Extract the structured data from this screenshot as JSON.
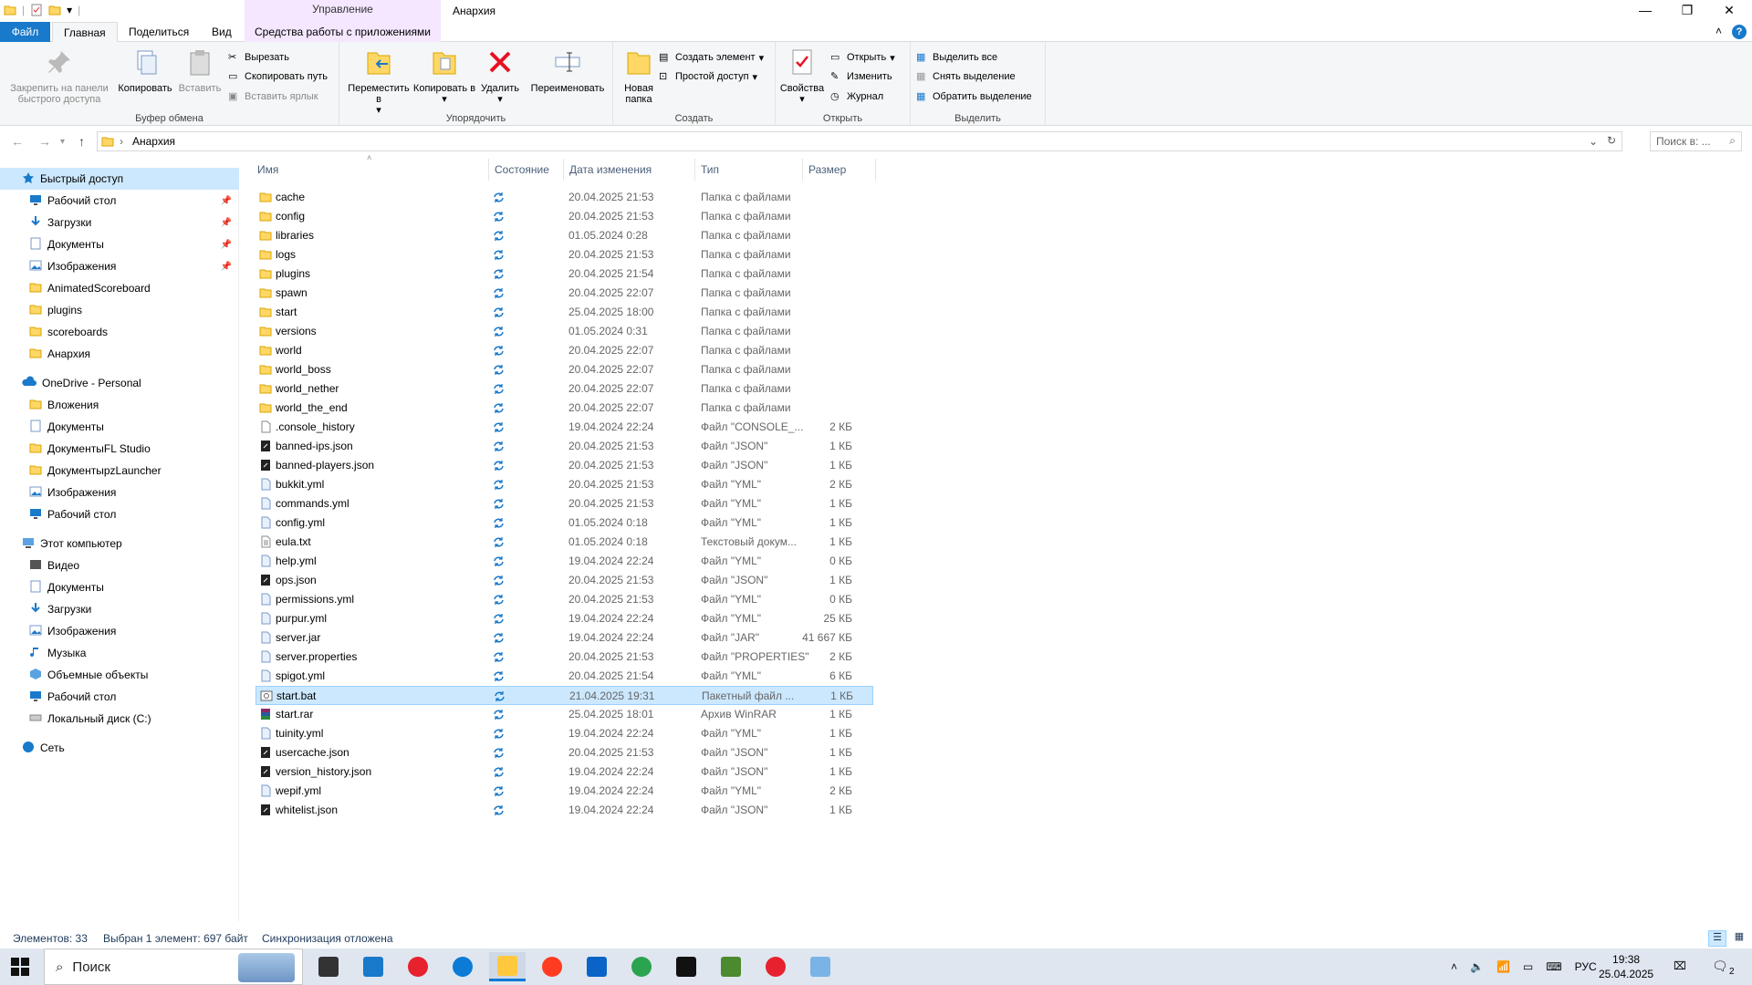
{
  "window": {
    "title": "Анархия",
    "context_tab": "Управление",
    "min_icon": "minimize-icon",
    "max_icon": "restore-icon",
    "close_icon": "close-icon"
  },
  "ribbon_tabs": [
    "Файл",
    "Главная",
    "Поделиться",
    "Вид",
    "Средства работы с приложениями"
  ],
  "clipboard": {
    "pin": "Закрепить на панели быстрого доступа",
    "copy": "Копировать",
    "paste": "Вставить",
    "cut": "Вырезать",
    "copy_path": "Скопировать путь",
    "paste_shortcut": "Вставить ярлык",
    "title": "Буфер обмена"
  },
  "organize": {
    "move": "Переместить в",
    "copy": "Копировать в",
    "delete": "Удалить",
    "rename": "Переименовать",
    "title": "Упорядочить"
  },
  "create": {
    "new_folder": "Новая папка",
    "new_item": "Создать элемент",
    "easy_access": "Простой доступ",
    "title": "Создать"
  },
  "open": {
    "properties": "Свойства",
    "open": "Открыть",
    "edit": "Изменить",
    "history": "Журнал",
    "title": "Открыть"
  },
  "select": {
    "all": "Выделить все",
    "none": "Снять выделение",
    "invert": "Обратить выделение",
    "title": "Выделить"
  },
  "address": {
    "path": "Анархия",
    "search_placeholder": "Поиск в: ..."
  },
  "nav_pane": [
    {
      "label": "Быстрый доступ",
      "icon": "star-icon",
      "level": 0,
      "pinned": false,
      "highlight": true
    },
    {
      "label": "Рабочий стол",
      "icon": "desktop-icon",
      "level": 1,
      "pinned": true
    },
    {
      "label": "Загрузки",
      "icon": "download-icon",
      "level": 1,
      "pinned": true
    },
    {
      "label": "Документы",
      "icon": "documents-icon",
      "level": 1,
      "pinned": true
    },
    {
      "label": "Изображения",
      "icon": "pictures-icon",
      "level": 1,
      "pinned": true
    },
    {
      "label": "AnimatedScoreboard",
      "icon": "folder-icon",
      "level": 1
    },
    {
      "label": "plugins",
      "icon": "folder-icon",
      "level": 1
    },
    {
      "label": "scoreboards",
      "icon": "folder-icon",
      "level": 1
    },
    {
      "label": "Анархия",
      "icon": "folder-icon",
      "level": 1
    },
    {
      "label": "OneDrive - Personal",
      "icon": "cloud-icon",
      "level": 0,
      "gap": true
    },
    {
      "label": "Вложения",
      "icon": "folder-icon",
      "level": 1
    },
    {
      "label": "Документы",
      "icon": "documents-icon",
      "level": 1
    },
    {
      "label": "ДокументыFL Studio",
      "icon": "folder-icon",
      "level": 1
    },
    {
      "label": "ДокументыpzLauncher",
      "icon": "folder-icon",
      "level": 1
    },
    {
      "label": "Изображения",
      "icon": "pictures-icon",
      "level": 1
    },
    {
      "label": "Рабочий стол",
      "icon": "desktop-icon",
      "level": 1
    },
    {
      "label": "Этот компьютер",
      "icon": "computer-icon",
      "level": 0,
      "gap": true
    },
    {
      "label": "Видео",
      "icon": "video-icon",
      "level": 1
    },
    {
      "label": "Документы",
      "icon": "documents-icon",
      "level": 1
    },
    {
      "label": "Загрузки",
      "icon": "download-icon",
      "level": 1
    },
    {
      "label": "Изображения",
      "icon": "pictures-icon",
      "level": 1
    },
    {
      "label": "Музыка",
      "icon": "music-icon",
      "level": 1
    },
    {
      "label": "Объемные объекты",
      "icon": "3d-objects-icon",
      "level": 1
    },
    {
      "label": "Рабочий стол",
      "icon": "desktop-icon",
      "level": 1
    },
    {
      "label": "Локальный диск (C:)",
      "icon": "drive-icon",
      "level": 1
    },
    {
      "label": "Сеть",
      "icon": "network-icon",
      "level": 0,
      "gap": true
    }
  ],
  "columns": {
    "name": "Имя",
    "status": "Состояние",
    "date": "Дата изменения",
    "type": "Тип",
    "size": "Размер"
  },
  "files": [
    {
      "name": "cache",
      "date": "20.04.2025 21:53",
      "type": "Папка с файлами",
      "size": "",
      "kind": "folder"
    },
    {
      "name": "config",
      "date": "20.04.2025 21:53",
      "type": "Папка с файлами",
      "size": "",
      "kind": "folder"
    },
    {
      "name": "libraries",
      "date": "01.05.2024 0:28",
      "type": "Папка с файлами",
      "size": "",
      "kind": "folder"
    },
    {
      "name": "logs",
      "date": "20.04.2025 21:53",
      "type": "Папка с файлами",
      "size": "",
      "kind": "folder"
    },
    {
      "name": "plugins",
      "date": "20.04.2025 21:54",
      "type": "Папка с файлами",
      "size": "",
      "kind": "folder"
    },
    {
      "name": "spawn",
      "date": "20.04.2025 22:07",
      "type": "Папка с файлами",
      "size": "",
      "kind": "folder"
    },
    {
      "name": "start",
      "date": "25.04.2025 18:00",
      "type": "Папка с файлами",
      "size": "",
      "kind": "folder"
    },
    {
      "name": "versions",
      "date": "01.05.2024 0:31",
      "type": "Папка с файлами",
      "size": "",
      "kind": "folder"
    },
    {
      "name": "world",
      "date": "20.04.2025 22:07",
      "type": "Папка с файлами",
      "size": "",
      "kind": "folder"
    },
    {
      "name": "world_boss",
      "date": "20.04.2025 22:07",
      "type": "Папка с файлами",
      "size": "",
      "kind": "folder"
    },
    {
      "name": "world_nether",
      "date": "20.04.2025 22:07",
      "type": "Папка с файлами",
      "size": "",
      "kind": "folder"
    },
    {
      "name": "world_the_end",
      "date": "20.04.2025 22:07",
      "type": "Папка с файлами",
      "size": "",
      "kind": "folder"
    },
    {
      "name": ".console_history",
      "date": "19.04.2024 22:24",
      "type": "Файл \"CONSOLE_...",
      "size": "2 КБ",
      "kind": "blank"
    },
    {
      "name": "banned-ips.json",
      "date": "20.04.2025 21:53",
      "type": "Файл \"JSON\"",
      "size": "1 КБ",
      "kind": "json"
    },
    {
      "name": "banned-players.json",
      "date": "20.04.2025 21:53",
      "type": "Файл \"JSON\"",
      "size": "1 КБ",
      "kind": "json"
    },
    {
      "name": "bukkit.yml",
      "date": "20.04.2025 21:53",
      "type": "Файл \"YML\"",
      "size": "2 КБ",
      "kind": "yml"
    },
    {
      "name": "commands.yml",
      "date": "20.04.2025 21:53",
      "type": "Файл \"YML\"",
      "size": "1 КБ",
      "kind": "yml"
    },
    {
      "name": "config.yml",
      "date": "01.05.2024 0:18",
      "type": "Файл \"YML\"",
      "size": "1 КБ",
      "kind": "yml"
    },
    {
      "name": "eula.txt",
      "date": "01.05.2024 0:18",
      "type": "Текстовый докум...",
      "size": "1 КБ",
      "kind": "txt"
    },
    {
      "name": "help.yml",
      "date": "19.04.2024 22:24",
      "type": "Файл \"YML\"",
      "size": "0 КБ",
      "kind": "yml"
    },
    {
      "name": "ops.json",
      "date": "20.04.2025 21:53",
      "type": "Файл \"JSON\"",
      "size": "1 КБ",
      "kind": "json"
    },
    {
      "name": "permissions.yml",
      "date": "20.04.2025 21:53",
      "type": "Файл \"YML\"",
      "size": "0 КБ",
      "kind": "yml"
    },
    {
      "name": "purpur.yml",
      "date": "19.04.2024 22:24",
      "type": "Файл \"YML\"",
      "size": "25 КБ",
      "kind": "yml"
    },
    {
      "name": "server.jar",
      "date": "19.04.2024 22:24",
      "type": "Файл \"JAR\"",
      "size": "41 667 КБ",
      "kind": "yml"
    },
    {
      "name": "server.properties",
      "date": "20.04.2025 21:53",
      "type": "Файл \"PROPERTIES\"",
      "size": "2 КБ",
      "kind": "yml"
    },
    {
      "name": "spigot.yml",
      "date": "20.04.2025 21:54",
      "type": "Файл \"YML\"",
      "size": "6 КБ",
      "kind": "yml"
    },
    {
      "name": "start.bat",
      "date": "21.04.2025 19:31",
      "type": "Пакетный файл ...",
      "size": "1 КБ",
      "kind": "bat",
      "selected": true
    },
    {
      "name": "start.rar",
      "date": "25.04.2025 18:01",
      "type": "Архив WinRAR",
      "size": "1 КБ",
      "kind": "rar"
    },
    {
      "name": "tuinity.yml",
      "date": "19.04.2024 22:24",
      "type": "Файл \"YML\"",
      "size": "1 КБ",
      "kind": "yml"
    },
    {
      "name": "usercache.json",
      "date": "20.04.2025 21:53",
      "type": "Файл \"JSON\"",
      "size": "1 КБ",
      "kind": "json"
    },
    {
      "name": "version_history.json",
      "date": "19.04.2024 22:24",
      "type": "Файл \"JSON\"",
      "size": "1 КБ",
      "kind": "json"
    },
    {
      "name": "wepif.yml",
      "date": "19.04.2024 22:24",
      "type": "Файл \"YML\"",
      "size": "2 КБ",
      "kind": "yml"
    },
    {
      "name": "whitelist.json",
      "date": "19.04.2024 22:24",
      "type": "Файл \"JSON\"",
      "size": "1 КБ",
      "kind": "json"
    }
  ],
  "status": {
    "count": "Элементов: 33",
    "selected": "Выбран 1 элемент: 697 байт",
    "sync": "Синхронизация отложена"
  },
  "taskbar": {
    "search": "Поиск",
    "lang": "РУС",
    "time": "19:38",
    "date": "25.04.2025",
    "notif_count": "2",
    "apps": [
      "task-view-icon",
      "app-icon",
      "yandex-icon",
      "edge-icon",
      "explorer-icon",
      "yandex-music-icon",
      "outlook-icon",
      "chrome-icon",
      "terminal-icon",
      "minecraft-icon",
      "yandex-browser-icon",
      "notepad-icon"
    ]
  },
  "colors": {
    "accent": "#1979ca",
    "selection": "#cce8ff",
    "folder": "#ffd767",
    "context": "#f4e7ff"
  }
}
